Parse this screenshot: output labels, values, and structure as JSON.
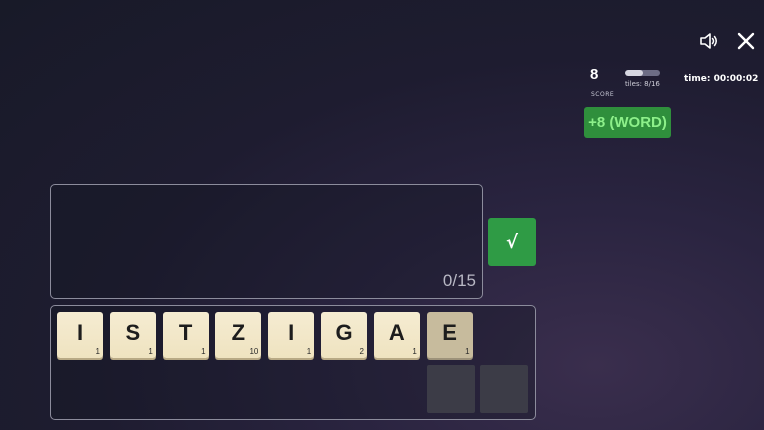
{
  "header": {
    "sound_icon": "speaker-icon",
    "close_icon": "close-icon"
  },
  "stats": {
    "score": "8",
    "score_label": "SCORE",
    "tiles_text": "tiles: 8/16",
    "tiles_used": 8,
    "tiles_total": 16,
    "time": "time: 00:00:02"
  },
  "badge": {
    "text": "+8 (WORD)"
  },
  "word_area": {
    "counter": "0/15"
  },
  "submit": {
    "label": "√"
  },
  "rack": {
    "tiles": [
      {
        "letter": "I",
        "points": "1",
        "used": false
      },
      {
        "letter": "S",
        "points": "1",
        "used": false
      },
      {
        "letter": "T",
        "points": "1",
        "used": false
      },
      {
        "letter": "Z",
        "points": "10",
        "used": false
      },
      {
        "letter": "I",
        "points": "1",
        "used": false
      },
      {
        "letter": "G",
        "points": "2",
        "used": false
      },
      {
        "letter": "A",
        "points": "1",
        "used": false
      },
      {
        "letter": "E",
        "points": "1",
        "used": true
      }
    ]
  },
  "colors": {
    "accent_green": "#2f9b45",
    "badge_text": "#8df08a",
    "tile": "#f5ecd2",
    "tile_used": "#c7bb9d"
  }
}
